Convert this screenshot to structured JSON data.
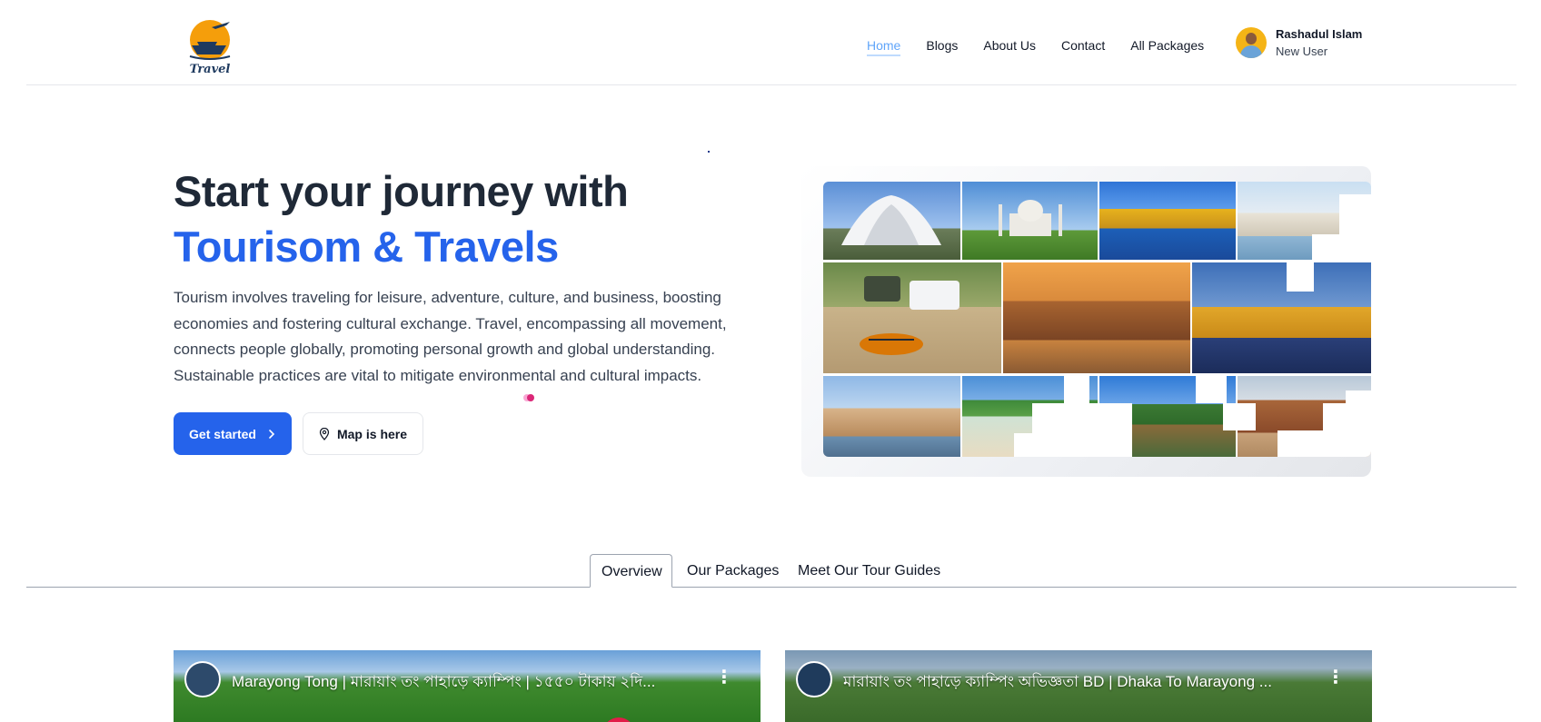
{
  "header": {
    "logo_text": "Travel",
    "nav": [
      {
        "label": "Home",
        "active": true
      },
      {
        "label": "Blogs",
        "active": false
      },
      {
        "label": "About Us",
        "active": false
      },
      {
        "label": "Contact",
        "active": false
      },
      {
        "label": "All Packages",
        "active": false
      }
    ],
    "user": {
      "name": "Rashadul Islam",
      "role": "New User"
    }
  },
  "hero": {
    "title_line1": "Start your journey with",
    "title_line2": "Tourisom & Travels",
    "description": "Tourism involves traveling for leisure, adventure, culture, and business, boosting economies and fostering cultural exchange. Travel, encompassing all movement, connects people globally, promoting personal growth and global understanding. Sustainable practices are vital to mitigate environmental and cultural impacts.",
    "primary_button": "Get started",
    "secondary_button": "Map is here"
  },
  "tabs": [
    {
      "label": "Overview",
      "active": true
    },
    {
      "label": "Our Packages",
      "active": false
    },
    {
      "label": "Meet Our Tour Guides",
      "active": false
    }
  ],
  "videos": [
    {
      "title": "Marayong Tong | মারায়াং তং পাহাড়ে ক্যাম্পিং | ১৫৫০ টাকায় ২দি..."
    },
    {
      "title": "মারায়াং তং পাহাড়ে ক্যাম্পিং অভিজ্ঞতা BD | Dhaka To Marayong ..."
    }
  ],
  "colors": {
    "accent": "#2563eb",
    "nav_active": "#60a5fa",
    "text": "#1f2937"
  }
}
